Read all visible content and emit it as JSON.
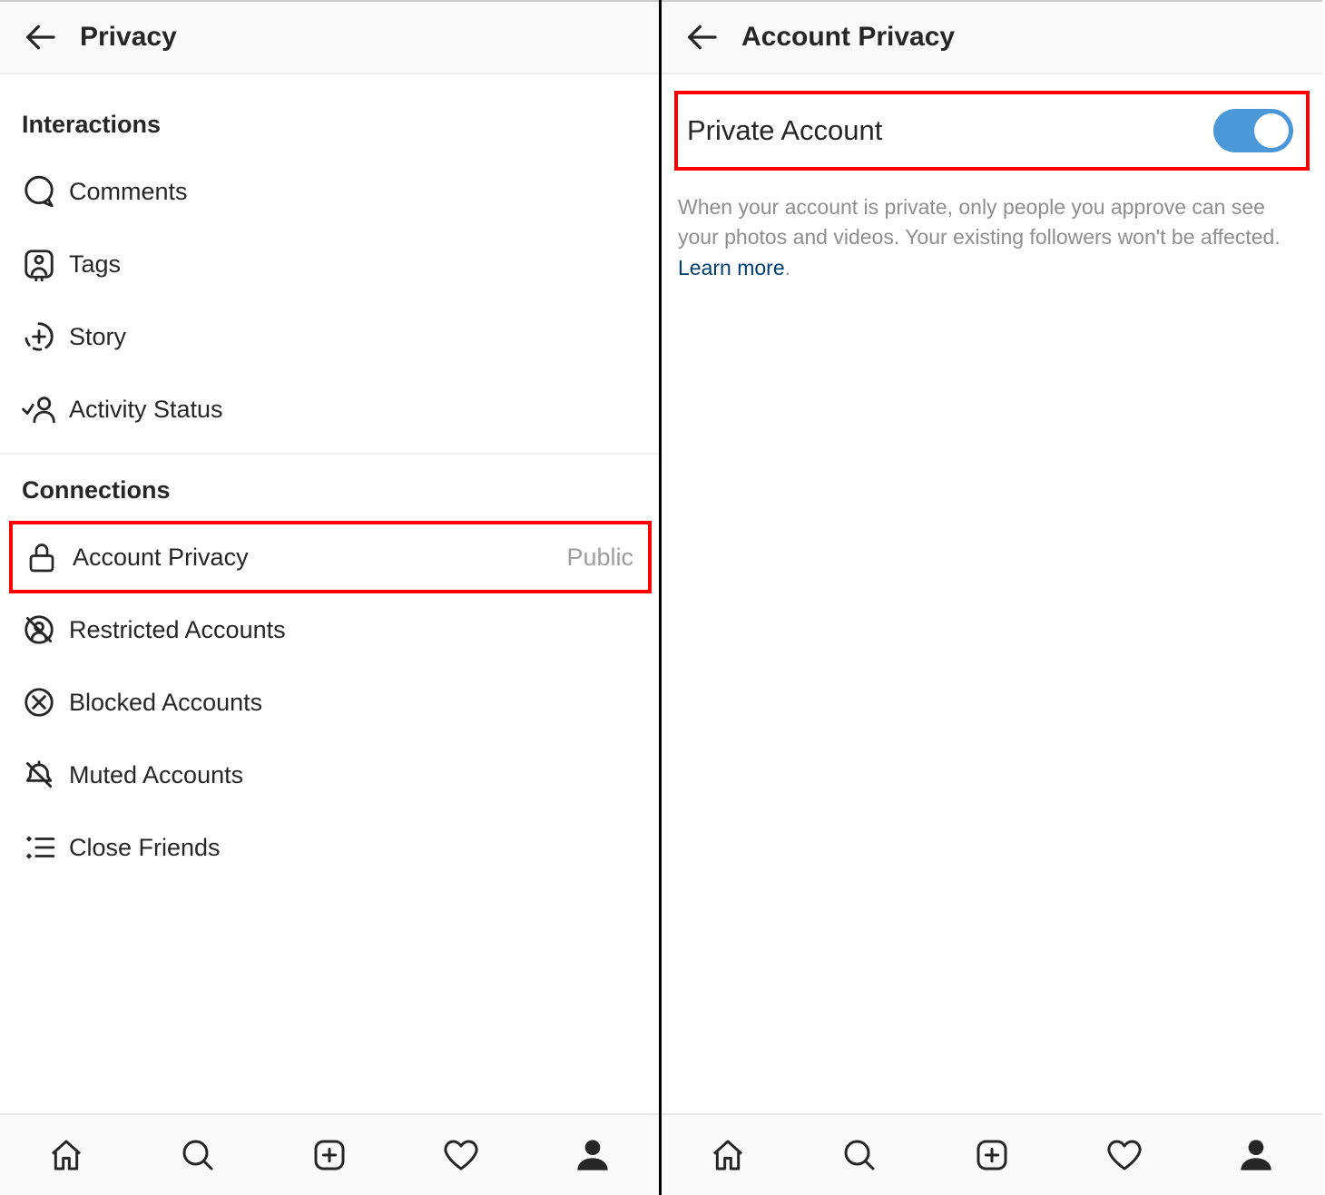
{
  "left": {
    "header_title": "Privacy",
    "sections": {
      "interactions": {
        "heading": "Interactions",
        "items": {
          "comments": "Comments",
          "tags": "Tags",
          "story": "Story",
          "activity_status": "Activity Status"
        }
      },
      "connections": {
        "heading": "Connections",
        "items": {
          "account_privacy": {
            "label": "Account Privacy",
            "value": "Public"
          },
          "restricted": "Restricted Accounts",
          "blocked": "Blocked Accounts",
          "muted": "Muted Accounts",
          "close_friends": "Close Friends"
        }
      }
    }
  },
  "right": {
    "header_title": "Account Privacy",
    "toggle_label": "Private Account",
    "toggle_on": true,
    "description": "When your account is private, only people you approve can see your photos and videos. Your existing followers won't be affected. ",
    "learn_more": "Learn more"
  },
  "colors": {
    "highlight": "#ff0000",
    "toggle_on_bg": "#4a98d8",
    "link": "#003e6f"
  }
}
